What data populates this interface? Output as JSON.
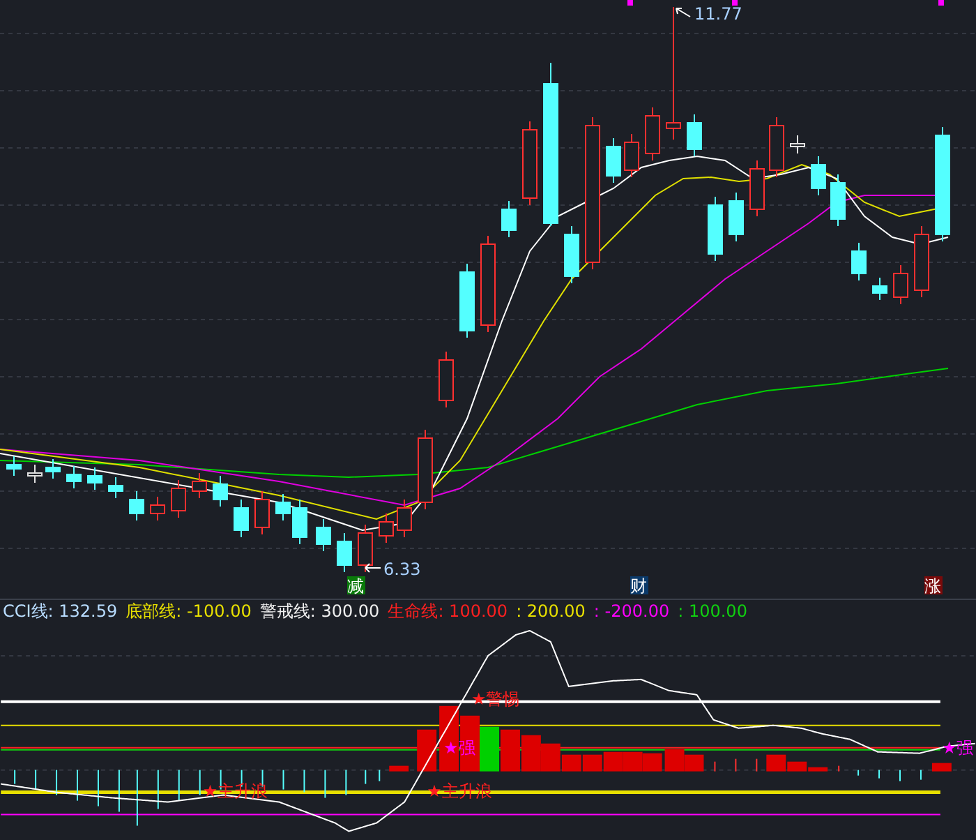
{
  "main_chart": {
    "high_label": "11.77",
    "low_label": "6.33"
  },
  "signal_badges": [
    {
      "text": "减",
      "color": "#0a7a0a"
    },
    {
      "text": "财",
      "color": "#0b3a6a"
    },
    {
      "text": "涨",
      "color": "#7a0a0a"
    }
  ],
  "legend": [
    {
      "text": "CCI线: 132.59",
      "color": "#b8dcff"
    },
    {
      "text": "底部线: -100.00",
      "color": "#e8e000"
    },
    {
      "text": "警戒线: 300.00",
      "color": "#f0f0f0"
    },
    {
      "text": "生命线: 100.00",
      "color": "#ff2020"
    },
    {
      "text": ": 200.00",
      "color": "#e8e000"
    },
    {
      "text": ": -200.00",
      "color": "#ff00ff"
    },
    {
      "text": ": 100.00",
      "color": "#10d010"
    }
  ],
  "indicator_signals": [
    {
      "text": "★警惕",
      "color": "#ff2020"
    },
    {
      "text": "★强",
      "color": "#ff00ff"
    },
    {
      "text": "★主升浪",
      "color": "#ff2020"
    },
    {
      "text": "★主升浪",
      "color": "#ff2020"
    },
    {
      "text": "★强",
      "color": "#ff00ff"
    }
  ]
}
